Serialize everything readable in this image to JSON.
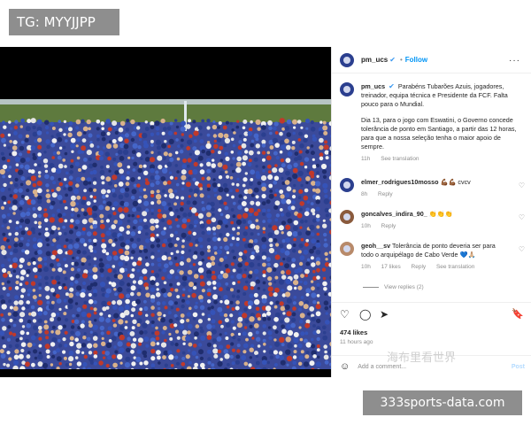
{
  "overlay": {
    "tg_label": "TG: MYYJJPP",
    "watermark": "海布里看世界",
    "site_label": "333sports-data.com"
  },
  "header": {
    "username": "pm_ucs",
    "verified_glyph": "✔",
    "separator": "•",
    "follow_label": "Follow",
    "more_glyph": "···"
  },
  "caption": {
    "username": "pm_ucs",
    "p1": "Parabéns Tubarões Azuis, jogadores, treinador, equipa técnica e Presidente da FCF. Falta pouco para o Mundial.",
    "p2": "Dia 13, para o jogo com Eswatini, o Governo concede tolerância de ponto em Santiago, a partir das 12 horas, para que a nossa seleção tenha o maior apoio de sempre.",
    "time": "11h",
    "see_translation": "See translation"
  },
  "comments": [
    {
      "username": "elmer_rodrigues10mosso",
      "text": "💪🏾💪🏾 cvcv",
      "time": "8h",
      "reply": "Reply"
    },
    {
      "username": "goncalves_indira_90_",
      "text": "👏👏👏",
      "time": "10h",
      "reply": "Reply"
    },
    {
      "username": "geoh__sv",
      "text": "Tolerância de ponto deveria ser para todo o arquipélago de Cabo Verde 💙🙏🏼",
      "time": "10h",
      "likes": "17 likes",
      "reply": "Reply",
      "see_translation": "See translation"
    }
  ],
  "view_replies": "View replies (2)",
  "actions": {
    "like_glyph": "♡",
    "comment_glyph": "◯",
    "share_glyph": "➤",
    "save_glyph": "🔖"
  },
  "likes": "474 likes",
  "time_ago": "11 hours ago",
  "add_comment": {
    "smile_glyph": "☺",
    "placeholder": "Add a comment...",
    "post_label": "Post"
  },
  "colors": {
    "accent": "#0095f6",
    "verified": "#3897f0",
    "crowd_blue": "#2b3f8f",
    "crowd_red": "#c0392b"
  }
}
